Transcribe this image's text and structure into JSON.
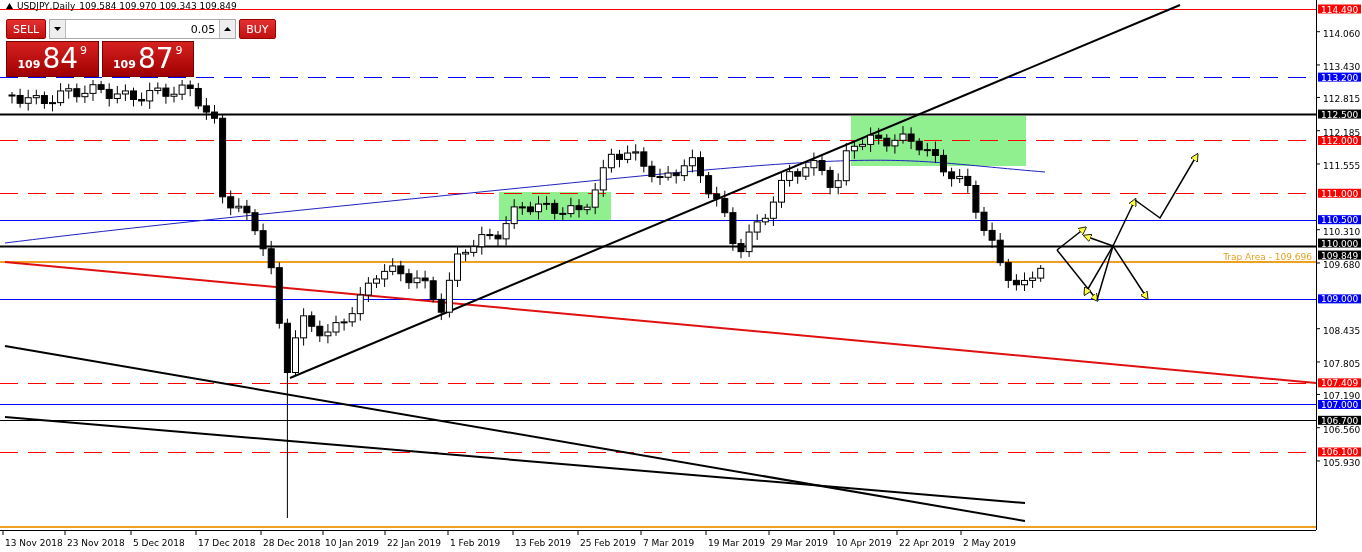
{
  "header": {
    "symbol": "USDJPY,Daily",
    "ohlc": "109.584 109.970 109.343 109.849"
  },
  "trade_panel": {
    "sell_label": "SELL",
    "buy_label": "BUY",
    "lot": "0.05",
    "sell_price": {
      "prefix": "109",
      "main": "84",
      "sup": "9"
    },
    "buy_price": {
      "prefix": "109",
      "main": "87",
      "sup": "9"
    }
  },
  "chart": {
    "levels": [
      {
        "label": "114.490",
        "color": "#ff0000",
        "kind": "solid"
      },
      {
        "label": "113.200",
        "color": "#0000ff",
        "kind": "dashed"
      },
      {
        "label": "112.500",
        "color": "#000000",
        "kind": "thick"
      },
      {
        "label": "112.000",
        "color": "#ff0000",
        "kind": "dashed"
      },
      {
        "label": "111.000",
        "color": "#ff0000",
        "kind": "dashed"
      },
      {
        "label": "110.500",
        "color": "#0000ff",
        "kind": "solid"
      },
      {
        "label": "110.000",
        "color": "#000000",
        "kind": "thick"
      },
      {
        "label": "109.849",
        "color": "#000000",
        "kind": "tag"
      },
      {
        "label": "109.000",
        "color": "#0000ff",
        "kind": "solid"
      },
      {
        "label": "107.409",
        "color": "#ff0000",
        "kind": "dashed"
      },
      {
        "label": "107.000",
        "color": "#0000ff",
        "kind": "solid"
      },
      {
        "label": "106.700",
        "color": "#000000",
        "kind": "solid"
      },
      {
        "label": "106.100",
        "color": "#ff0000",
        "kind": "dashed"
      }
    ],
    "price_ticks": [
      "114.060",
      "113.430",
      "112.815",
      "112.185",
      "111.555",
      "110.310",
      "109.680",
      "108.435",
      "107.805",
      "107.190",
      "106.560",
      "105.930"
    ],
    "trap_label": "Trap Area - 109.696",
    "date_labels": [
      "13 Nov 2018",
      "23 Nov 2018",
      "5 Dec 2018",
      "17 Dec 2018",
      "28 Dec 2018",
      "10 Jan 2019",
      "22 Jan 2019",
      "1 Feb 2019",
      "13 Feb 2019",
      "25 Feb 2019",
      "7 Mar 2019",
      "19 Mar 2019",
      "29 Mar 2019",
      "10 Apr 2019",
      "22 Apr 2019",
      "2 May 2019"
    ]
  }
}
